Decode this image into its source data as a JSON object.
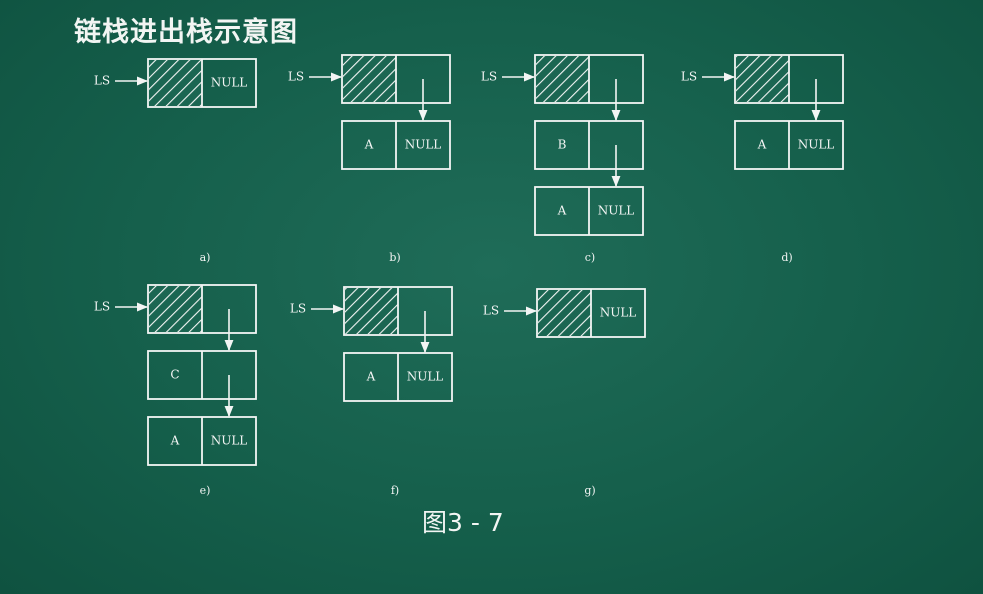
{
  "title": "链栈进出栈示意图",
  "figure_caption": "图3 - 7",
  "pointer_label": "LS",
  "null_label": "NULL",
  "colors": {
    "background": "#155f4b",
    "chalk": "#f3f5f4"
  },
  "panels": [
    {
      "id": "a",
      "label": "a)",
      "head_next": "NULL",
      "nodes": []
    },
    {
      "id": "b",
      "label": "b)",
      "head_next": "",
      "nodes": [
        {
          "value": "A",
          "next": "NULL"
        }
      ]
    },
    {
      "id": "c",
      "label": "c)",
      "head_next": "",
      "nodes": [
        {
          "value": "B",
          "next": ""
        },
        {
          "value": "A",
          "next": "NULL"
        }
      ]
    },
    {
      "id": "d",
      "label": "d)",
      "head_next": "",
      "nodes": [
        {
          "value": "A",
          "next": "NULL"
        }
      ]
    },
    {
      "id": "e",
      "label": "e)",
      "head_next": "",
      "nodes": [
        {
          "value": "C",
          "next": ""
        },
        {
          "value": "A",
          "next": "NULL"
        }
      ]
    },
    {
      "id": "f",
      "label": "f)",
      "head_next": "",
      "nodes": [
        {
          "value": "A",
          "next": "NULL"
        }
      ]
    },
    {
      "id": "g",
      "label": "g)",
      "head_next": "NULL",
      "nodes": []
    }
  ]
}
